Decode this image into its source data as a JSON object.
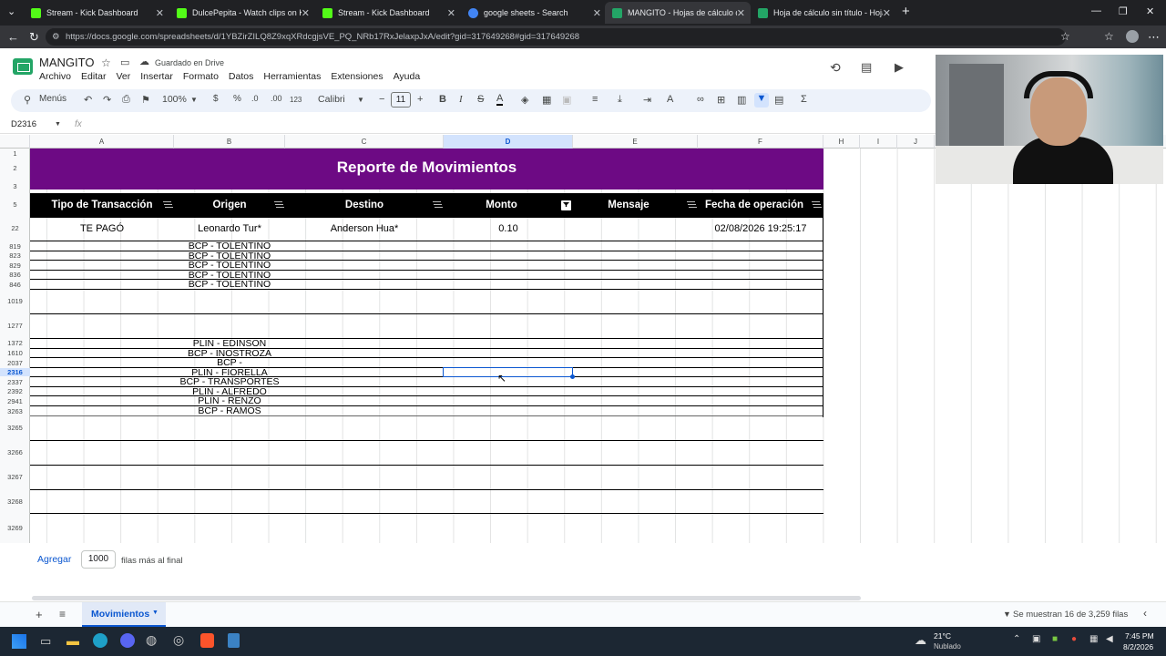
{
  "browser": {
    "tabs": [
      {
        "title": "Stream - Kick Dashboard",
        "color": "#53fc18"
      },
      {
        "title": "DulcePepita - Watch clips on Kick",
        "color": "#53fc18"
      },
      {
        "title": "Stream - Kick Dashboard",
        "color": "#53fc18"
      },
      {
        "title": "google sheets - Search",
        "color": "#4285f4"
      },
      {
        "title": "MANGITO - Hojas de cálculo de G",
        "color": "#23a566"
      },
      {
        "title": "Hoja de cálculo sin título - Hojas d",
        "color": "#23a566"
      }
    ],
    "url": "https://docs.google.com/spreadsheets/d/1YBZirZILQ8Z9xqXRdcgjsVE_PQ_NRb17RxJelaxpJxA/edit?gid=317649268#gid=317649268"
  },
  "doc": {
    "title": "MANGITO",
    "saved_status": "Guardado en Drive",
    "menu": [
      "Archivo",
      "Editar",
      "Ver",
      "Insertar",
      "Formato",
      "Datos",
      "Herramientas",
      "Extensiones",
      "Ayuda"
    ]
  },
  "toolbar": {
    "menus_label": "Menús",
    "zoom": "100%",
    "currency": "$",
    "percent": "%",
    "decrease_decimals": ".0",
    "increase_decimals": ".00",
    "number_format": "123",
    "font": "Calibri",
    "font_size": "11"
  },
  "formula_bar": {
    "name_box": "D2316",
    "fx_label": "fx"
  },
  "columns": [
    "A",
    "B",
    "C",
    "D",
    "E",
    "F",
    "H",
    "I",
    "J"
  ],
  "sheet": {
    "title": "Reporte de Movimientos",
    "headers": [
      "Tipo de Transacción",
      "Origen",
      "Destino",
      "Monto",
      "Mensaje",
      "Fecha de operación"
    ],
    "row_numbers": [
      "1",
      "2",
      "3",
      "5",
      "22",
      "819",
      "823",
      "829",
      "836",
      "846",
      "1019",
      "1277",
      "1372",
      "1610",
      "2037",
      "2316",
      "2337",
      "2392",
      "2941",
      "3263",
      "3265",
      "3266",
      "3267",
      "3268",
      "3269"
    ],
    "first_row": {
      "tipo": "TE PAGÓ",
      "origen": "Leonardo Tur*",
      "destino": "Anderson Hua*",
      "monto": "0.10",
      "mensaje": "",
      "fecha": "02/08/2026 19:25:17"
    },
    "origins": [
      "BCP - TOLENTINO",
      "BCP - TOLENTINO",
      "BCP - TOLENTINO",
      "BCP - TOLENTINO",
      "BCP - TOLENTINO",
      "",
      "",
      "PLIN - EDINSON",
      "BCP - INOSTROZA",
      "BCP -",
      "PLIN - FIORELLA",
      "BCP - TRANSPORTES",
      "PLIN - ALFREDO",
      "PLIN - RENZO",
      "BCP - RAMOS"
    ]
  },
  "add_rows": {
    "button": "Agregar",
    "count": "1000",
    "suffix": "filas más al final"
  },
  "sheet_tabs": {
    "active": "Movimientos",
    "status": "Se muestran 16 de 3,259 filas"
  },
  "taskbar": {
    "weather_temp": "21°C",
    "weather_desc": "Nublado",
    "time": "7:45 PM",
    "date": "8/2/2026"
  }
}
